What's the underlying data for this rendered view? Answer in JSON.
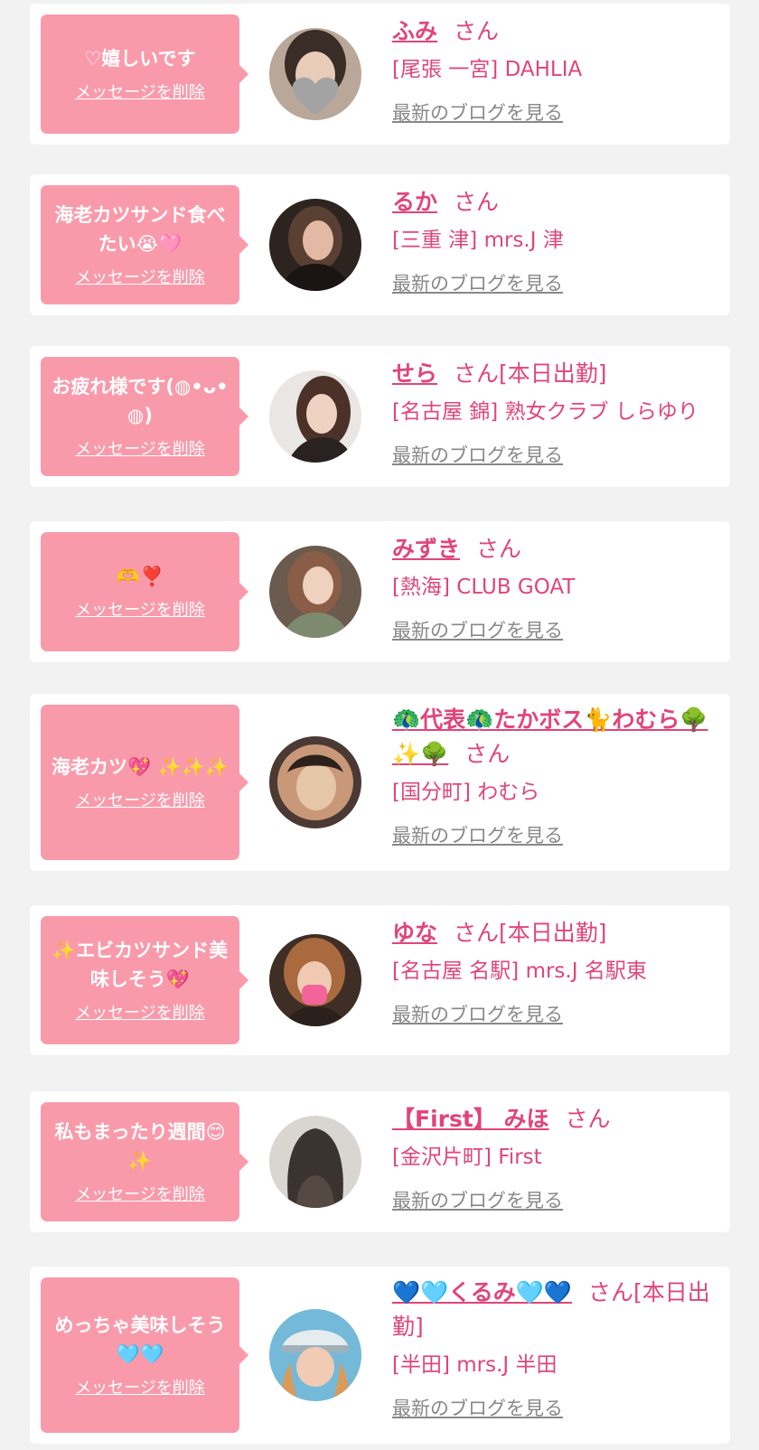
{
  "colors": {
    "accent": "#e0457a",
    "bubble": "#f99aab",
    "muted": "#888888",
    "background": "#f2f2f2"
  },
  "labels": {
    "delete": "メッセージを削除",
    "blog": "最新のブログを見る"
  },
  "items": [
    {
      "message": "♡嬉しいです",
      "name": "ふみ",
      "suffix": "さん",
      "shop": "[尾張 一宮] DAHLIA"
    },
    {
      "message": "海老カツサンド食べたい😭🩷",
      "name": "るか",
      "suffix": "さん",
      "shop": "[三重 津] mrs.J 津"
    },
    {
      "message": "お疲れ様です(◍•ᴗ•◍)",
      "name": "せら",
      "suffix": "さん[本日出勤]",
      "shop": "[名古屋 錦] 熟女クラブ しらゆり"
    },
    {
      "message": "🫶❣️",
      "name": "みずき",
      "suffix": "さん",
      "shop": "[熱海] CLUB GOAT"
    },
    {
      "message": "海老カツ💖 ✨✨✨",
      "name": "🦚代表🦚たかボス🐈わむら🌳✨🌳",
      "suffix": "さん",
      "shop": "[国分町] わむら"
    },
    {
      "message": "✨エビカツサンド美味しそう💖",
      "name": "ゆな",
      "suffix": "さん[本日出勤]",
      "shop": "[名古屋 名駅] mrs.J 名駅東"
    },
    {
      "message": "私もまったり週間😊✨",
      "name": "【First】 みほ",
      "suffix": "さん",
      "shop": "[金沢片町] First"
    },
    {
      "message": "めっちゃ美味しそう🩵🩵",
      "name": "💙🩵くるみ🩵💙",
      "suffix": "さん[本日出勤]",
      "shop": "[半田] mrs.J 半田"
    }
  ]
}
